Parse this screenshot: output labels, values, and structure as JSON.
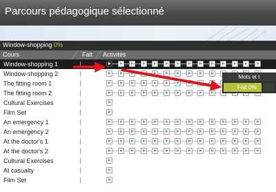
{
  "window": {
    "title": "Parcours pédagogique sélectionné"
  },
  "path_bar": {
    "name": "Window-shopping",
    "progress_label": "0%"
  },
  "columns": {
    "cours": "Cours",
    "fait": "Fait",
    "activites": "Activités"
  },
  "courses": [
    {
      "label": "Window-shopping 1",
      "selected": true,
      "activities": 14
    },
    {
      "label": "Window-shopping 2",
      "selected": false,
      "activities": 14
    },
    {
      "label": "The fitting room 1",
      "selected": false,
      "activities": 14
    },
    {
      "label": "The fitting room 2",
      "selected": false,
      "activities": 14
    },
    {
      "label": "Cultural Exercises",
      "selected": false,
      "activities": 1
    },
    {
      "label": "Film Set",
      "selected": false,
      "activities": 1
    },
    {
      "label": "An emergency 1",
      "selected": false,
      "activities": 14
    },
    {
      "label": "An emergency 2",
      "selected": false,
      "activities": 14
    },
    {
      "label": "At the doctor's 1",
      "selected": false,
      "activities": 14
    },
    {
      "label": "At the doctor's 2",
      "selected": false,
      "activities": 14
    },
    {
      "label": "Cultural Exercises",
      "selected": false,
      "activities": 1
    },
    {
      "label": "At casualty",
      "selected": false,
      "activities": 1
    },
    {
      "label": "Film Set",
      "selected": false,
      "activities": 1
    }
  ],
  "popup": {
    "title": "Mots et t",
    "fait_label": "Fait",
    "percent": "0%"
  },
  "colors": {
    "accent_green": "#b6c43c",
    "arrow_red": "#e0141b"
  }
}
